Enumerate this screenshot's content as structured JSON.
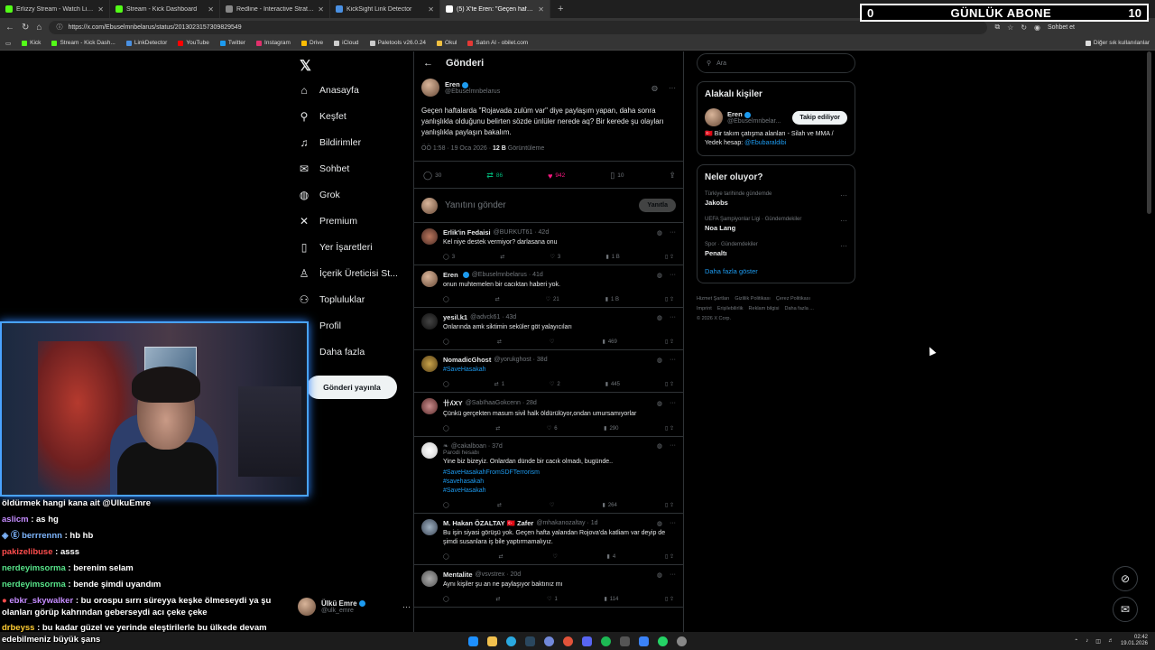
{
  "overlay": {
    "left": "0",
    "title": "GÜNLÜK ABONE",
    "right": "10"
  },
  "browser": {
    "tabs": [
      {
        "label": "Erlizzy Stream - Watch Live on Kick",
        "color": "#53fc18"
      },
      {
        "label": "Stream - Kick Dashboard",
        "color": "#53fc18"
      },
      {
        "label": "Redline - Interactive Strategic Map",
        "color": "#888888"
      },
      {
        "label": "KickSight Link Detector",
        "color": "#4a90e2"
      },
      {
        "label": "(5) X'te Eren: \"Geçen haftalarda \"R",
        "color": "#ffffff"
      }
    ],
    "url": "https://x.com/Ebuselmnbelarus/status/2013023157309829549",
    "chat_label": "Sohbet et",
    "bookmarks": [
      {
        "label": "Kick",
        "color": "#53fc18"
      },
      {
        "label": "Stream - Kick Dash...",
        "color": "#53fc18"
      },
      {
        "label": "LinkDetector",
        "color": "#4a90e2"
      },
      {
        "label": "YouTube",
        "color": "#ff0000"
      },
      {
        "label": "Twitter",
        "color": "#1d9bf0"
      },
      {
        "label": "Instagram",
        "color": "#e1306c"
      },
      {
        "label": "Drive",
        "color": "#fbbc04"
      },
      {
        "label": "iCloud",
        "color": "#cccccc"
      },
      {
        "label": "Paletools v26.0.24",
        "color": "#cccccc"
      },
      {
        "label": "Okul",
        "color": "#f0c040"
      },
      {
        "label": "Satın Al - obilet.com",
        "color": "#e53935"
      }
    ],
    "bookmarks_other": "Diğer sık kullanılanlar"
  },
  "nav": {
    "items": [
      {
        "label": "Anasayfa",
        "icon": "⌂"
      },
      {
        "label": "Keşfet",
        "icon": "⚲"
      },
      {
        "label": "Bildirimler",
        "icon": "🔔"
      },
      {
        "label": "Sohbet",
        "icon": "✉"
      },
      {
        "label": "Grok",
        "icon": "◍"
      },
      {
        "label": "Premium",
        "icon": "✕"
      },
      {
        "label": "Yer İşaretleri",
        "icon": "▯"
      },
      {
        "label": "İçerik Üreticisi St...",
        "icon": "♙"
      },
      {
        "label": "Topluluklar",
        "icon": "⚇"
      },
      {
        "label": "Profil",
        "icon": "♟"
      },
      {
        "label": "Daha fazla",
        "icon": "⋯"
      }
    ],
    "post_button": "Gönderi yayınla",
    "user": {
      "name": "Ülkü Emre",
      "handle": "@ulk_emre"
    }
  },
  "main": {
    "title": "Gönderi",
    "op": {
      "name": "Eren",
      "handle": "@Ebuselmnbelarus",
      "text": "Geçen haftalarda \"Rojavada zulüm var\" diye paylaşım yapan, daha sonra yanlışlıkla olduğunu belirten sözde ünlüler nerede aq? Bir kerede şu olayları yanlışlıkla paylaşın bakalım.",
      "time": "ÖÖ 1:58 · 19 Oca 2026 ·",
      "views": "12 B",
      "views_label": "Görüntüleme",
      "replies": "30",
      "reposts": "86",
      "likes": "942",
      "bookmarks": "10"
    },
    "reply_placeholder": "Yanıtını gönder",
    "reply_button": "Yanıtla",
    "replies": [
      {
        "name": "Erlik'in Fedaisi",
        "handle": "@BURKUT61 · 42d",
        "text": "Kel niye destek vermiyor? darlasana onu",
        "tag": "",
        "r": "3",
        "rt": "",
        "l": "3",
        "v": "1 B"
      },
      {
        "name": "Eren",
        "handle": "@Ebuselmnbelarus · 41d",
        "text": "onun muhtemelen bir cacıktan haberi yok.",
        "tag": "",
        "r": "",
        "rt": "",
        "l": "21",
        "v": "1 B"
      },
      {
        "name": "yesil.k1",
        "handle": "@advck61 · 43d",
        "text": "Onlarında amk siktimin seküler göt yalayıcıları",
        "tag": "",
        "r": "",
        "rt": "",
        "l": "",
        "v": "469"
      },
      {
        "name": "NomadicGhost",
        "handle": "@yorukghost · 38d",
        "text": "",
        "tag": "#SaveHasakah",
        "r": "",
        "rt": "1",
        "l": "2",
        "v": "445"
      },
      {
        "name": "卄ʎXY",
        "handle": "@SabIhaaGokcenn · 28d",
        "text": "Çünkü gerçekten masum sivil halk öldürülüyor,ondan umursamıyorlar",
        "tag": "",
        "r": "",
        "rt": "",
        "l": "6",
        "v": "290"
      },
      {
        "name": "",
        "handle": "@cakalboan · 37d",
        "sub": "Parodi hesabı",
        "text": "Yine biz bizeyiz. Onlardan dünde bir cacık olmadı, bugünde..",
        "tag": "#SaveHasakahFromSDFTerrorism\n#savehasakah\n#SaveHasakah",
        "r": "",
        "rt": "",
        "l": "",
        "v": "264"
      },
      {
        "name": "M. Hakan ÖZALTAY 🇹🇷 Zafer",
        "handle": "@mhakanozaltay · 1d",
        "text": "Bu işin siyasi görüşü yok. Geçen hafta yalandan Rojova'da katliam var deyip de şimdi susanlara iş bile yaptırmamalıyız.",
        "tag": "",
        "r": "",
        "rt": "",
        "l": "4",
        "v": ""
      },
      {
        "name": "Mentalite",
        "handle": "@vsvstrex · 20d",
        "text": "Aynı kişiler şu an ne paylaşıyor baktınız mı",
        "tag": "",
        "r": "",
        "rt": "",
        "l": "1",
        "v": "114"
      }
    ]
  },
  "right": {
    "search_placeholder": "Ara",
    "related_title": "Alakalı kişiler",
    "related": {
      "name": "Eren",
      "handle": "@Ebuselmnbelar...",
      "follow": "Takip ediliyor",
      "bio": "🇹🇷 Bir takım çatışma alanları - Silah ve MMA / Yedek hesap:",
      "bio_tag": "@Ebubaraldibi"
    },
    "trends_title": "Neler oluyor?",
    "trends": [
      {
        "context": "Türkiye tarihinde gündemde",
        "title": "Jakobs"
      },
      {
        "context": "UEFA Şampiyonlar Ligi · Gündemdekiler",
        "title": "Noa Lang"
      },
      {
        "context": "Spor · Gündemdekiler",
        "title": "Penaltı"
      }
    ],
    "show_more": "Daha fazla göster",
    "footer": [
      "Hizmet Şartları",
      "Gizlilik Politikası",
      "Çerez Politikası",
      "Imprint",
      "Erişilebilirlik",
      "Reklam bilgisi",
      "Daha fazla ...",
      "© 2026 X Corp."
    ]
  },
  "chat": [
    {
      "user": "",
      "text": "öldürmek hangi kana ait @UlkuEmre",
      "color": "#ffffff"
    },
    {
      "user": "aslicm",
      "text": ": as hg",
      "color": "#c58cff"
    },
    {
      "user": "berrrennn",
      "text": ": hb hb",
      "color": "#7fb7ff"
    },
    {
      "user": "pakizelibuse",
      "text": ": asss",
      "color": "#ff4d4d"
    },
    {
      "user": "nerdeyimsorma",
      "text": ": berenim selam",
      "color": "#57e389"
    },
    {
      "user": "nerdeyimsorma",
      "text": ": bende şimdi uyandım",
      "color": "#57e389"
    },
    {
      "user": "ebkr_skywalker",
      "text": ": bu orospu sırrı süreyya keşke ölmeseydi ya şu olanları görüp kahrından geberseydi acı çeke çeke",
      "color": "#c58cff"
    },
    {
      "user": "drbeyss",
      "text": ": bu kadar güzel ve yerinde eleştirilerle bu ülkede devam edebilmeniz büyük şans",
      "color": "#ffcc33"
    }
  ],
  "taskbar": {
    "time": "02:42",
    "date": "19.01.2026"
  }
}
